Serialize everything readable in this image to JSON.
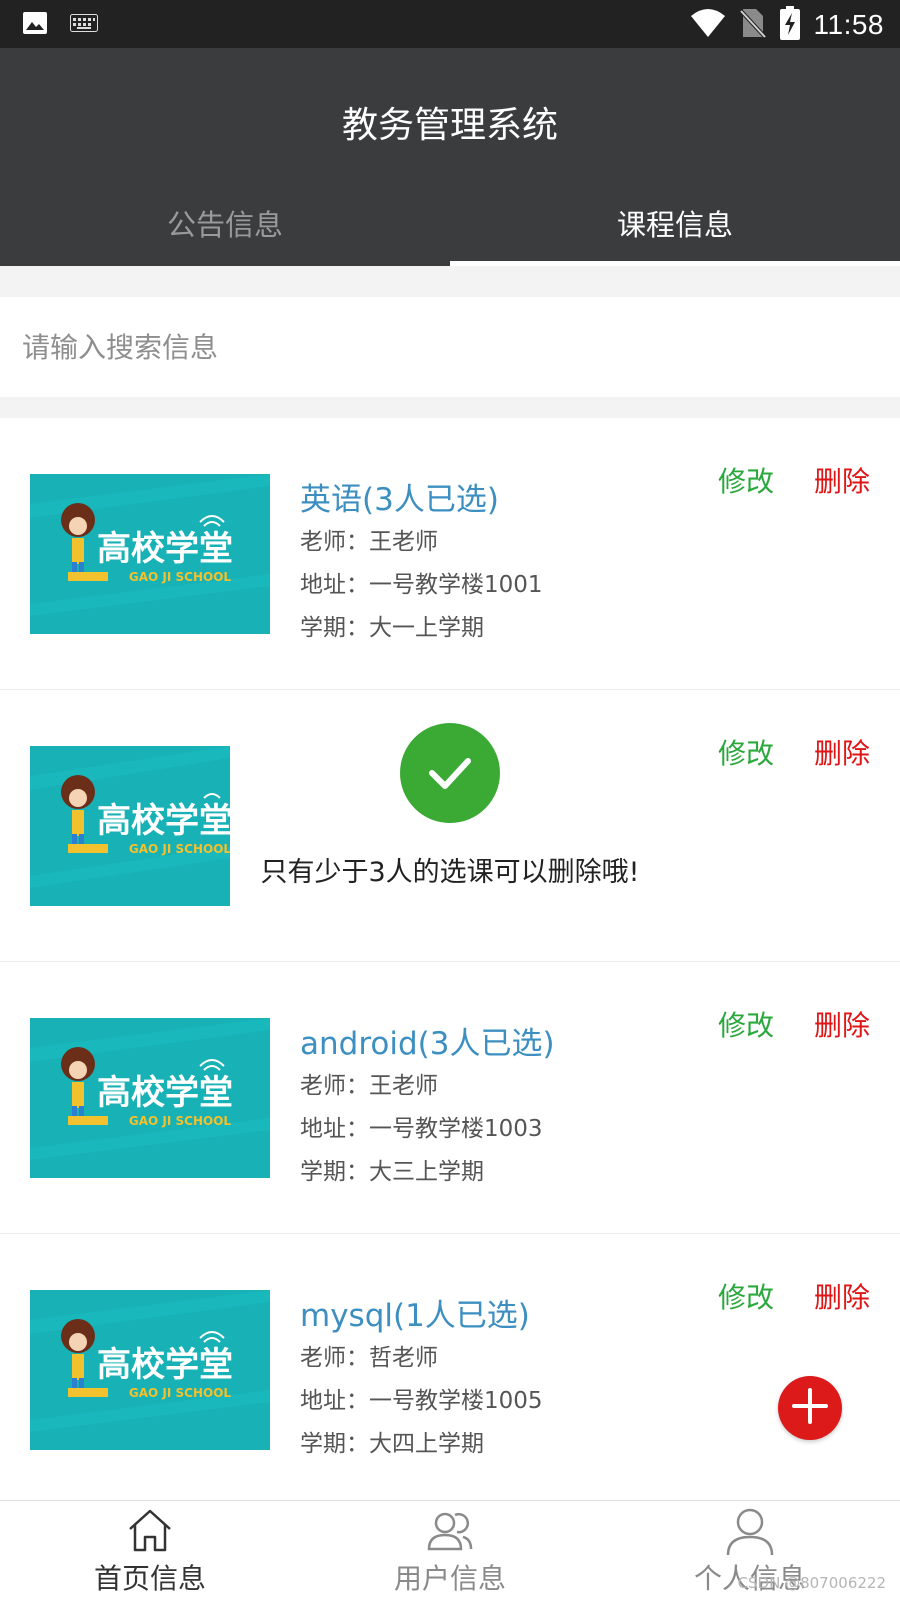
{
  "status_bar": {
    "time": "11:58",
    "left_icons": [
      "image-icon",
      "keyboard-icon"
    ],
    "right_icons": [
      "wifi-icon",
      "no-sim-icon",
      "battery-charging-icon"
    ]
  },
  "app": {
    "title": "教务管理系统",
    "tabs": [
      {
        "label": "公告信息",
        "active": false
      },
      {
        "label": "课程信息",
        "active": true
      }
    ]
  },
  "search": {
    "placeholder": "请输入搜索信息",
    "value": ""
  },
  "courses": [
    {
      "name": "英语(3人已选)",
      "teacher": "老师：王老师",
      "address": "地址：一号教学楼1001",
      "term": "学期：大一上学期",
      "edit_label": "修改",
      "delete_label": "删除"
    },
    {
      "name": "",
      "teacher": "",
      "address": "",
      "term": "",
      "edit_label": "修改",
      "delete_label": "删除"
    },
    {
      "name": "android(3人已选)",
      "teacher": "老师：王老师",
      "address": "地址：一号教学楼1003",
      "term": "学期：大三上学期",
      "edit_label": "修改",
      "delete_label": "删除"
    },
    {
      "name": "mysql(1人已选)",
      "teacher": "老师：哲老师",
      "address": "地址：一号教学楼1005",
      "term": "学期：大四上学期",
      "edit_label": "修改",
      "delete_label": "删除"
    }
  ],
  "thumbnail": {
    "brand_text": "高校学堂",
    "sub_text": "GAO JI SCHOOL"
  },
  "toast": {
    "message": "只有少于3人的选课可以删除哦!",
    "icon": "check-circle-icon"
  },
  "fab": {
    "icon": "plus-icon"
  },
  "bottom_nav": [
    {
      "label": "首页信息",
      "icon": "home-icon",
      "active": true
    },
    {
      "label": "用户信息",
      "icon": "users-icon",
      "active": false
    },
    {
      "label": "个人信息",
      "icon": "person-icon",
      "active": false
    }
  ],
  "watermark": "CSDN @807006222",
  "colors": {
    "status_bar": "#222222",
    "app_bar": "#3b3c3e",
    "course_name": "#3d8fc1",
    "edit": "#2aa83c",
    "delete": "#e01414",
    "thumbnail_bg": "#17b1b6",
    "toast_check": "#3aaa35",
    "fab": "#dc1a1a"
  }
}
